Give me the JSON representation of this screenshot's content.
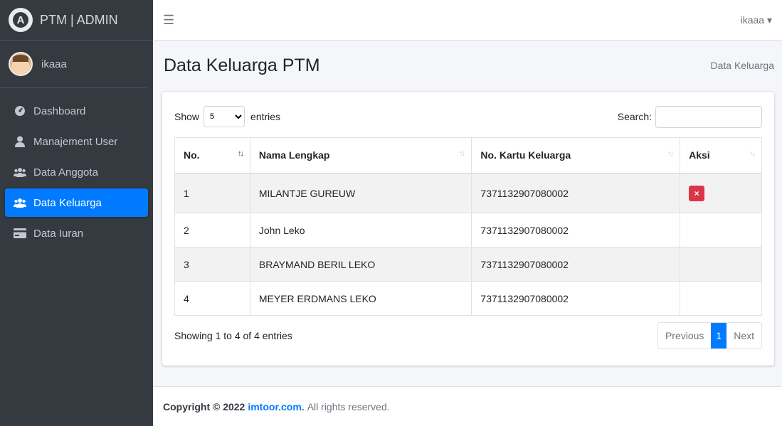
{
  "brand": {
    "title": "PTM | ADMIN"
  },
  "user": {
    "name": "ikaaa"
  },
  "sidebar": {
    "items": [
      {
        "label": "Dashboard",
        "icon": "dashboard-icon"
      },
      {
        "label": "Manajement User",
        "icon": "user-icon"
      },
      {
        "label": "Data Anggota",
        "icon": "users-icon"
      },
      {
        "label": "Data Keluarga",
        "icon": "users-icon",
        "active": true
      },
      {
        "label": "Data Iuran",
        "icon": "card-icon"
      }
    ]
  },
  "topbar": {
    "user_label": "ikaaa ▾"
  },
  "header": {
    "title": "Data Keluarga PTM",
    "breadcrumb": "Data Keluarga"
  },
  "table_controls": {
    "show_label": "Show",
    "entries_label": "entries",
    "page_length": "5",
    "search_label": "Search:",
    "search_value": ""
  },
  "table": {
    "columns": [
      "No.",
      "Nama Lengkap",
      "No. Kartu Keluarga",
      "Aksi"
    ],
    "rows": [
      {
        "no": "1",
        "nama": "MILANTJE GUREUW",
        "kk": "7371132907080002",
        "aksi": "×"
      },
      {
        "no": "2",
        "nama": "John Leko",
        "kk": "7371132907080002",
        "aksi": ""
      },
      {
        "no": "3",
        "nama": "BRAYMAND BERIL LEKO",
        "kk": "7371132907080002",
        "aksi": ""
      },
      {
        "no": "4",
        "nama": "MEYER ERDMANS LEKO",
        "kk": "7371132907080002",
        "aksi": ""
      }
    ]
  },
  "info": "Showing 1 to 4 of 4 entries",
  "pagination": {
    "previous": "Previous",
    "current": "1",
    "next": "Next"
  },
  "footer": {
    "prefix": "Copyright © 2022",
    "link": "imtoor.com.",
    "suffix": "All rights reserved."
  },
  "colors": {
    "sidebar": "#343a40",
    "accent": "#007bff",
    "danger": "#dc3545"
  }
}
